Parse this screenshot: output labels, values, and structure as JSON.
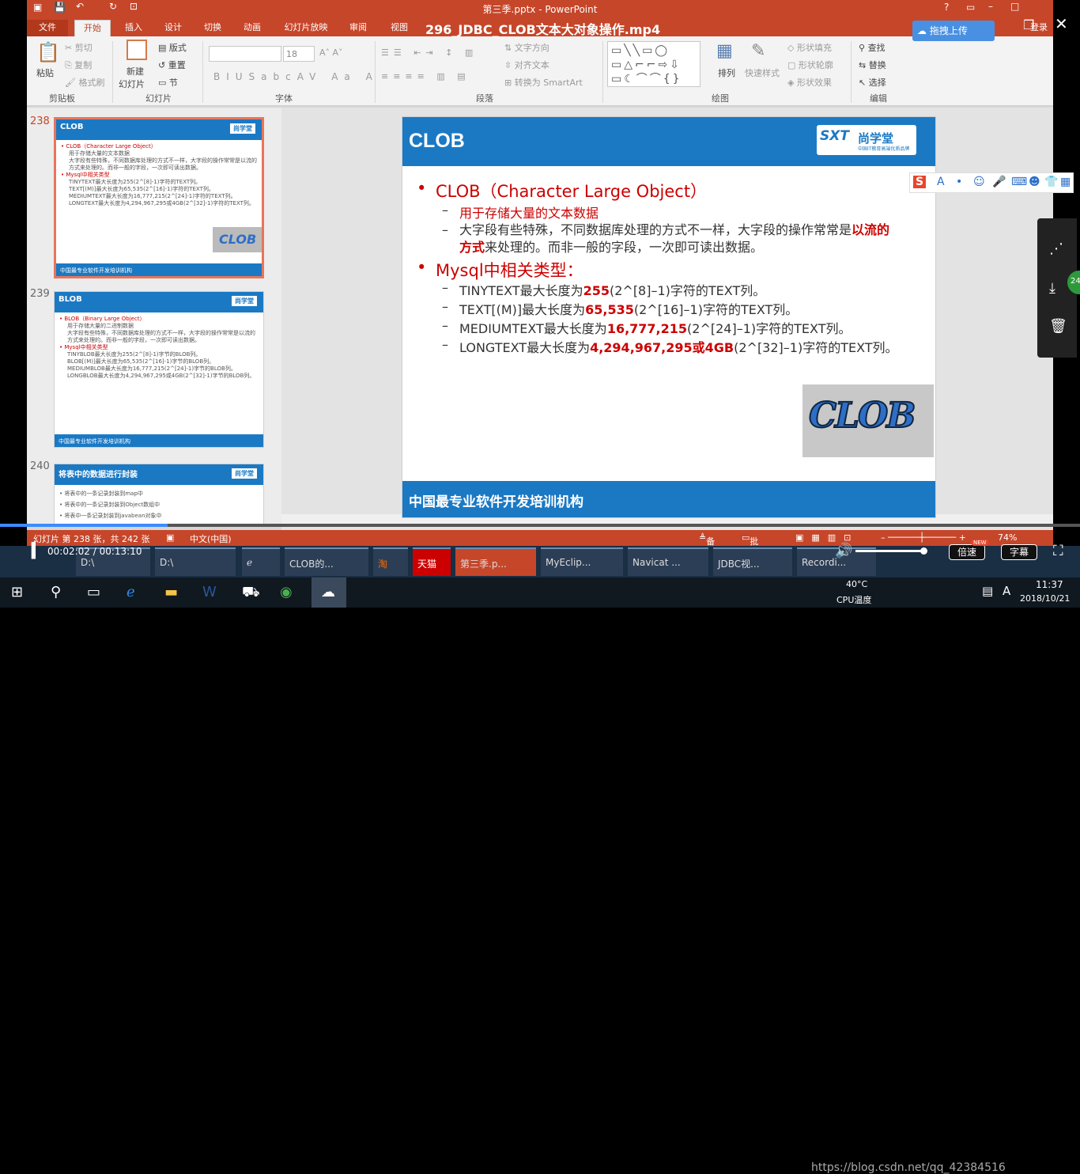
{
  "player": {
    "title": "296_JDBC_CLOB文本大对象操作.mp4",
    "upload": "拖拽上传",
    "time": "00:02:02 / 00:13:10",
    "speed": "倍速",
    "speed_badge": "NEW",
    "subtitle": "字幕",
    "progress": 0.155
  },
  "ppt": {
    "window_title": "第三季.pptx - PowerPoint",
    "tabs": [
      "文件",
      "开始",
      "插入",
      "设计",
      "切换",
      "动画",
      "幻灯片放映",
      "审阅",
      "视图"
    ],
    "account": "登录",
    "ribbon": {
      "clipboard": {
        "paste": "粘贴",
        "cut": "剪切",
        "copy": "复制",
        "format_painter": "格式刷",
        "group": "剪贴板"
      },
      "slides": {
        "new": "新建",
        "new2": "幻灯片",
        "layout": "版式",
        "reset": "重置",
        "section": "节",
        "group": "幻灯片"
      },
      "font": {
        "size": "18",
        "group": "字体"
      },
      "paragraph": {
        "text_dir": "文字方向",
        "align_text": "对齐文本",
        "smartart": "转换为 SmartArt",
        "group": "段落"
      },
      "drawing": {
        "arrange": "排列",
        "quick_styles": "快速样式",
        "fill": "形状填充",
        "outline": "形状轮廓",
        "effects": "形状效果",
        "group": "绘图"
      },
      "editing": {
        "find": "查找",
        "replace": "替换",
        "select": "选择",
        "group": "编辑"
      }
    },
    "thumbs": [
      {
        "num": "238",
        "title": "CLOB",
        "b1": "CLOB（Character Large Object）",
        "s1": "用于存储大量的文本数据",
        "s2": "大字段有些特殊，不同数据库处理的方式不一样，大字段的操作常常是以流的方式来处理的。而非一般的字段，一次即可读出数据。",
        "b2": "Mysql中相关类型",
        "r1": "TINYTEXT最大长度为255(2^[8]-1)字符的TEXT列。",
        "r2": "TEXT[(M)]最大长度为65,535(2^[16]-1)字符的TEXT列。",
        "r3": "MEDIUMTEXT最大长度为16,777,215(2^[24]-1)字符的TEXT列。",
        "r4": "LONGTEXT最大长度为4,294,967,295或4GB(2^[32]-1)字符的TEXT列。"
      },
      {
        "num": "239",
        "title": "BLOB",
        "b1": "BLOB（Binary Large Object）",
        "s1": "用于存储大量的二进制数据",
        "s2": "大字段有些特殊，不同数据库处理的方式不一样，大字段的操作常常是以流的方式来处理的。而非一般的字段，一次即可读出数据。",
        "b2": "Mysql中相关类型",
        "r1": "TINYBLOB最大长度为255(2^[8]-1)字节的BLOB列。",
        "r2": "BLOB[(M)]最大长度为65,535(2^[16]-1)字节的BLOB列。",
        "r3": "MEDIUMBLOB最大长度为16,777,215(2^[24]-1)字节的BLOB列。",
        "r4": "LONGBLOB最大长度为4,294,967,295或4GB(2^[32]-1)字节的BLOB列。"
      },
      {
        "num": "240",
        "title": "将表中的数据进行封装",
        "r1": "将表中的一条记录封装到map中",
        "r2": "将表中的一条记录封装到Object数组中",
        "r3": "将表中一条记录封装到javabean对象中"
      }
    ],
    "thumb_footer": "中国最专业软件开发培训机构",
    "logo_a": "SXT",
    "logo_b": "尚学堂",
    "logo_c": "中国IT教育高端优质品牌",
    "slide": {
      "title": "CLOB",
      "b1": "CLOB（Character Large Object）",
      "s1": "用于存储大量的文本数据",
      "s2a": "大字段有些特殊，不同数据库处理的方式不一样，大字段的操作常常是",
      "s2b": "以流的",
      "s2c": "方式",
      "s2d": "来处理的。而非一般的字段，一次即可读出数据。",
      "b2": "Mysql中相关类型：",
      "rows": [
        {
          "a": "TINYTEXT最大长度为",
          "v": "255",
          "c": "(2^[8]–1)字符的TEXT列。"
        },
        {
          "a": "TEXT[(M)]最大长度为",
          "v": "65,535",
          "c": "(2^[16]–1)字符的TEXT列。"
        },
        {
          "a": "MEDIUMTEXT最大长度为",
          "v": "16,777,215",
          "c": "(2^[24]–1)字符的TEXT列。"
        },
        {
          "a": "LONGTEXT最大长度为",
          "v": "4,294,967,295或4GB",
          "c": "(2^[32]–1)字符的TEXT列。"
        }
      ],
      "image_text": "CLOB",
      "footer": "中国最专业软件开发培训机构"
    },
    "status": {
      "slide": "幻灯片 第 238 张，共 242 张",
      "lang": "中文(中国)",
      "notes": "备注",
      "comments": "批注",
      "zoom": "74%"
    }
  },
  "taskbar": {
    "apps": [
      "D:\\",
      "D:\\",
      "CLOB的...",
      "第三季.p...",
      "MyEclip...",
      "Navicat ...",
      "JDBC视...",
      "Recordi..."
    ],
    "temp": "40°C",
    "temp_label": "CPU温度",
    "time": "11:37",
    "date": "2018/10/21",
    "watermark": "https://blog.csdn.net/qq_42384516",
    "side_badge": "24"
  }
}
